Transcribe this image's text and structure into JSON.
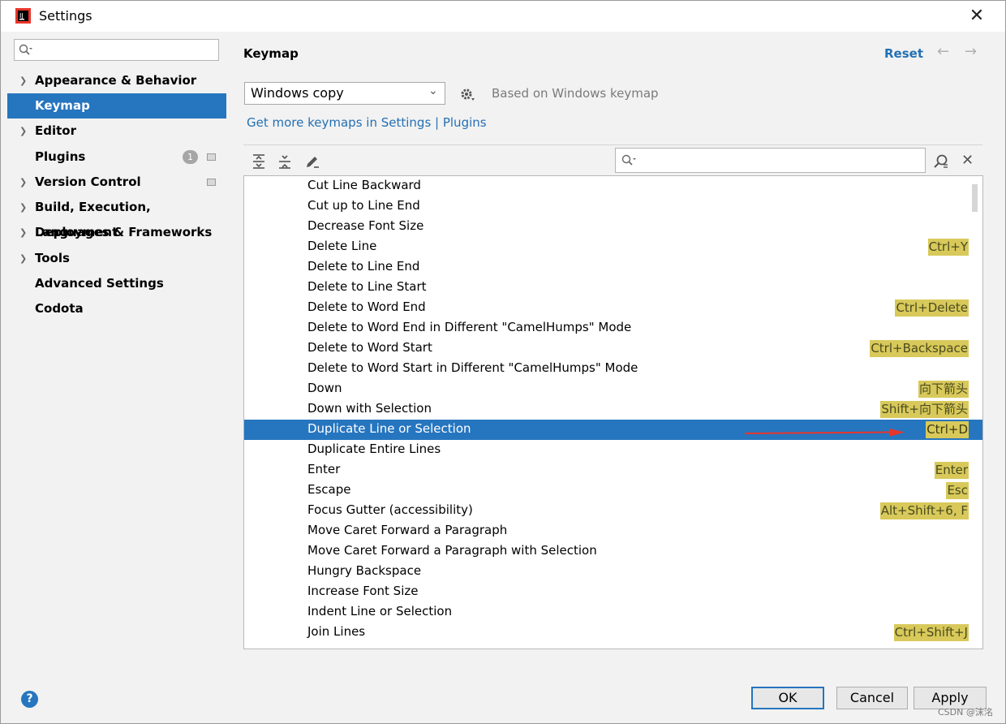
{
  "window": {
    "title": "Settings"
  },
  "sidebar": {
    "search_placeholder": "",
    "items": [
      {
        "label": "Appearance & Behavior",
        "expandable": true
      },
      {
        "label": "Keymap",
        "expandable": false,
        "selected": true
      },
      {
        "label": "Editor",
        "expandable": true
      },
      {
        "label": "Plugins",
        "expandable": false,
        "badge": "1"
      },
      {
        "label": "Version Control",
        "expandable": true
      },
      {
        "label": "Build, Execution, Deployment",
        "expandable": true
      },
      {
        "label": "Languages & Frameworks",
        "expandable": true
      },
      {
        "label": "Tools",
        "expandable": true
      },
      {
        "label": "Advanced Settings",
        "expandable": false
      },
      {
        "label": "Codota",
        "expandable": false
      }
    ]
  },
  "main": {
    "heading": "Keymap",
    "reset_label": "Reset",
    "keymap_selected": "Windows copy",
    "based_on": "Based on Windows keymap",
    "more_keymaps_link": "Get more keymaps in Settings | Plugins",
    "filter_value": ""
  },
  "actions": [
    {
      "name": "Cut Line Backward",
      "shortcut": ""
    },
    {
      "name": "Cut up to Line End",
      "shortcut": ""
    },
    {
      "name": "Decrease Font Size",
      "shortcut": ""
    },
    {
      "name": "Delete Line",
      "shortcut": "Ctrl+Y"
    },
    {
      "name": "Delete to Line End",
      "shortcut": ""
    },
    {
      "name": "Delete to Line Start",
      "shortcut": ""
    },
    {
      "name": "Delete to Word End",
      "shortcut": "Ctrl+Delete"
    },
    {
      "name": "Delete to Word End in Different \"CamelHumps\" Mode",
      "shortcut": ""
    },
    {
      "name": "Delete to Word Start",
      "shortcut": "Ctrl+Backspace"
    },
    {
      "name": "Delete to Word Start in Different \"CamelHumps\" Mode",
      "shortcut": ""
    },
    {
      "name": "Down",
      "shortcut": "向下箭头"
    },
    {
      "name": "Down with Selection",
      "shortcut": "Shift+向下箭头"
    },
    {
      "name": "Duplicate Line or Selection",
      "shortcut": "Ctrl+D",
      "selected": true
    },
    {
      "name": "Duplicate Entire Lines",
      "shortcut": ""
    },
    {
      "name": "Enter",
      "shortcut": "Enter"
    },
    {
      "name": "Escape",
      "shortcut": "Esc"
    },
    {
      "name": "Focus Gutter (accessibility)",
      "shortcut": "Alt+Shift+6, F"
    },
    {
      "name": "Move Caret Forward a Paragraph",
      "shortcut": ""
    },
    {
      "name": "Move Caret Forward a Paragraph with Selection",
      "shortcut": ""
    },
    {
      "name": "Hungry Backspace",
      "shortcut": ""
    },
    {
      "name": "Increase Font Size",
      "shortcut": ""
    },
    {
      "name": "Indent Line or Selection",
      "shortcut": ""
    },
    {
      "name": "Join Lines",
      "shortcut": "Ctrl+Shift+J"
    }
  ],
  "footer": {
    "ok_label": "OK",
    "cancel_label": "Cancel",
    "apply_label": "Apply",
    "watermark": "CSDN @沫洺"
  },
  "colors": {
    "selection": "#2675bf",
    "link": "#2470b3",
    "shortcut_highlight": "#d8c95a",
    "annotation_arrow": "#e8352b"
  }
}
